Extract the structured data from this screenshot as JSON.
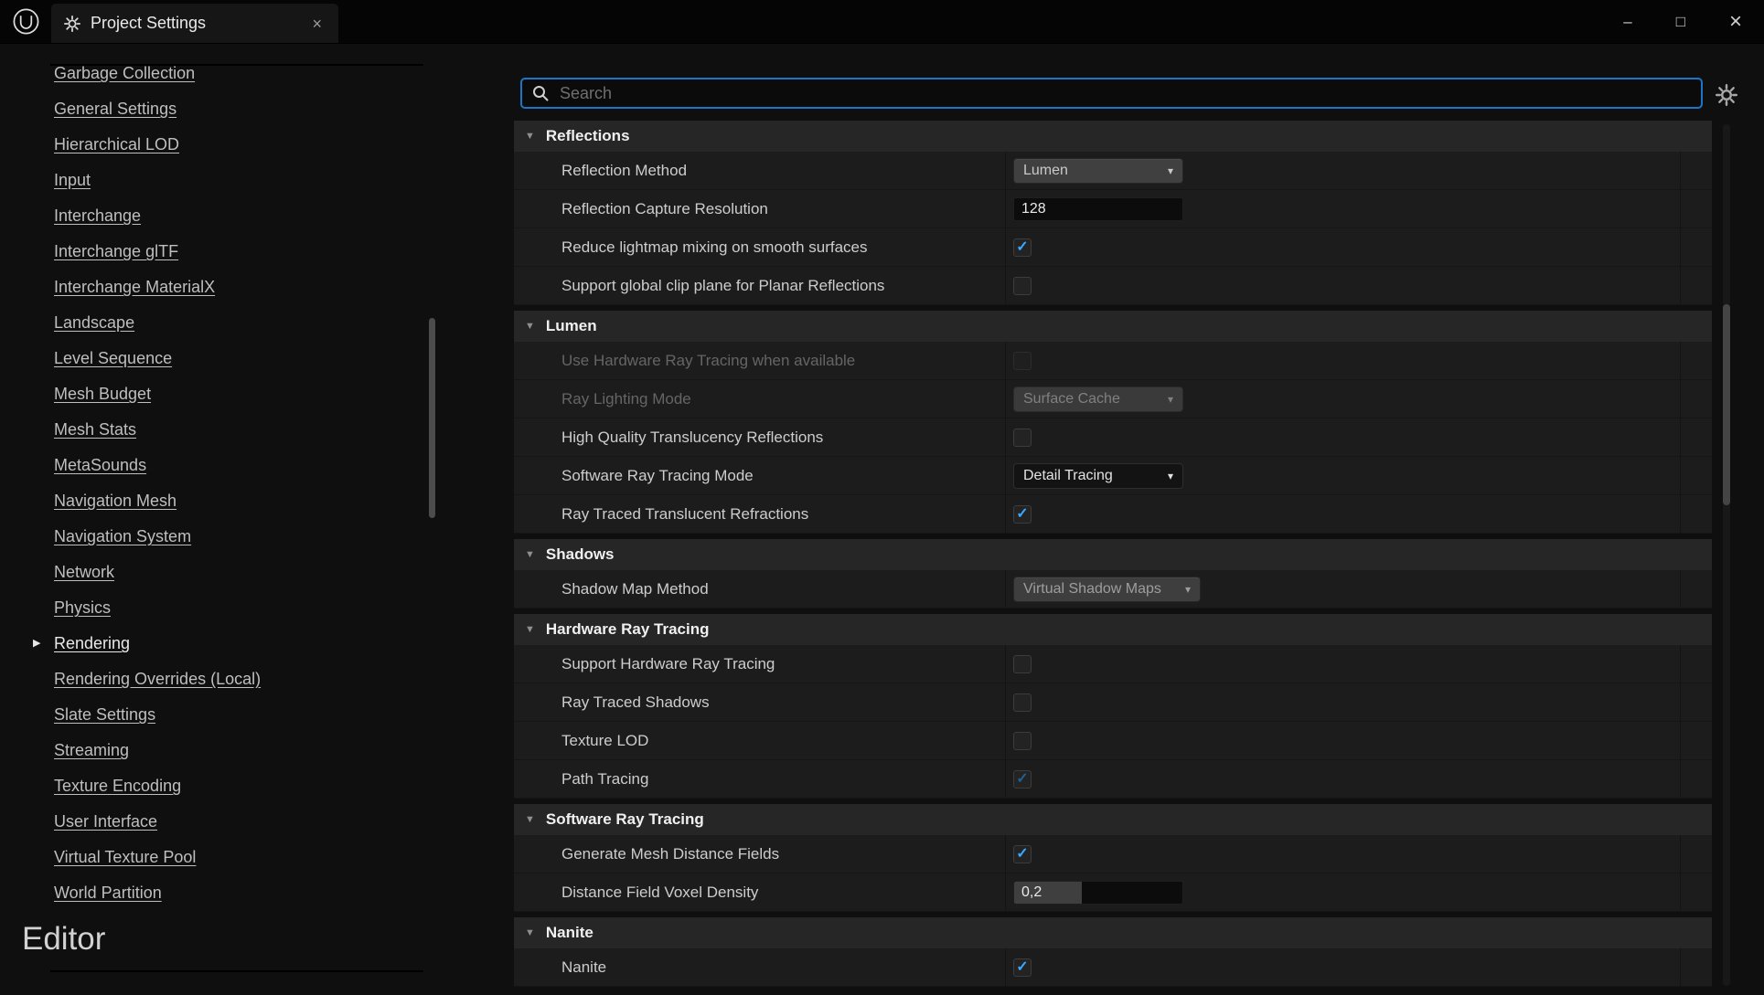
{
  "window": {
    "tab_title": "Project Settings"
  },
  "icons": {
    "minimize": "–",
    "maximize": "□",
    "close": "×",
    "triangle_down": "▼",
    "arrow_right": "▶",
    "chevron_down": "▾"
  },
  "search": {
    "placeholder": "Search"
  },
  "sidebar": {
    "selected_index": 16,
    "footer_section": "Editor",
    "items": [
      "Garbage Collection",
      "General Settings",
      "Hierarchical LOD",
      "Input",
      "Interchange",
      "Interchange glTF",
      "Interchange MaterialX",
      "Landscape",
      "Level Sequence",
      "Mesh Budget",
      "Mesh Stats",
      "MetaSounds",
      "Navigation Mesh",
      "Navigation System",
      "Network",
      "Physics",
      "Rendering",
      "Rendering Overrides (Local)",
      "Slate Settings",
      "Streaming",
      "Texture Encoding",
      "User Interface",
      "Virtual Texture Pool",
      "World Partition"
    ]
  },
  "sections": [
    {
      "title": "Reflections",
      "rows": [
        {
          "label": "Reflection Method",
          "widget": "dropdown",
          "value": "Lumen",
          "style": "light"
        },
        {
          "label": "Reflection Capture Resolution",
          "widget": "input",
          "value": "128"
        },
        {
          "label": "Reduce lightmap mixing on smooth surfaces",
          "widget": "checkbox",
          "checked": true
        },
        {
          "label": "Support global clip plane for Planar Reflections",
          "widget": "checkbox",
          "checked": false
        }
      ]
    },
    {
      "title": "Lumen",
      "rows": [
        {
          "label": "Use Hardware Ray Tracing when available",
          "widget": "checkbox",
          "checked": false,
          "disabled": true
        },
        {
          "label": "Ray Lighting Mode",
          "widget": "dropdown",
          "value": "Surface Cache",
          "style": "disabled",
          "disabled": true
        },
        {
          "label": "High Quality Translucency Reflections",
          "widget": "checkbox",
          "checked": false
        },
        {
          "label": "Software Ray Tracing Mode",
          "widget": "dropdown",
          "value": "Detail Tracing",
          "style": "dark"
        },
        {
          "label": "Ray Traced Translucent Refractions",
          "widget": "checkbox",
          "checked": true
        }
      ]
    },
    {
      "title": "Shadows",
      "rows": [
        {
          "label": "Shadow Map Method",
          "widget": "dropdown",
          "value": "Virtual Shadow Maps",
          "style": "muted wide"
        }
      ]
    },
    {
      "title": "Hardware Ray Tracing",
      "rows": [
        {
          "label": "Support Hardware Ray Tracing",
          "widget": "checkbox",
          "checked": false
        },
        {
          "label": "Ray Traced Shadows",
          "widget": "checkbox",
          "checked": false
        },
        {
          "label": "Texture LOD",
          "widget": "checkbox",
          "checked": false
        },
        {
          "label": "Path Tracing",
          "widget": "checkbox",
          "checked": true,
          "muted": true
        }
      ]
    },
    {
      "title": "Software Ray Tracing",
      "rows": [
        {
          "label": "Generate Mesh Distance Fields",
          "widget": "checkbox",
          "checked": true
        },
        {
          "label": "Distance Field Voxel Density",
          "widget": "slider",
          "value": "0,2",
          "fill": 0.4
        }
      ]
    },
    {
      "title": "Nanite",
      "rows": [
        {
          "label": "Nanite",
          "widget": "checkbox",
          "checked": true
        }
      ]
    }
  ]
}
